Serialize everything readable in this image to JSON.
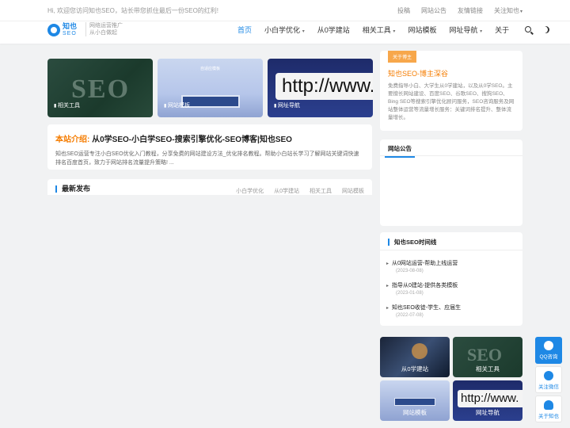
{
  "topbar": {
    "welcome": "Hi, 欢迎您访问知也SEO，站长带您抓住最后一份SEO的红利!",
    "links": [
      "投稿",
      "网站公告",
      "友情链接",
      "关注知也"
    ]
  },
  "header": {
    "logo_cn": "知也",
    "logo_en": "SEO",
    "slogan_1": "网络运营推广",
    "slogan_2": "从小白做起",
    "nav": [
      {
        "label": "首页",
        "dropdown": false
      },
      {
        "label": "小白学优化",
        "dropdown": true
      },
      {
        "label": "从0学建站",
        "dropdown": false
      },
      {
        "label": "相关工具",
        "dropdown": true
      },
      {
        "label": "网站模板",
        "dropdown": false
      },
      {
        "label": "网址导航",
        "dropdown": true
      },
      {
        "label": "关于",
        "dropdown": false
      }
    ],
    "accent": "#1e88e5"
  },
  "banners": [
    {
      "label": "相关工具",
      "art": "SEO"
    },
    {
      "label": "网站模板",
      "art": "自适应模板"
    },
    {
      "label": "网址导航",
      "art": "http://www."
    }
  ],
  "intro": {
    "tag": "本站介绍:",
    "title": "从0学SEO-小白学SEO-搜索引擎优化-SEO博客|知也SEO",
    "desc": "知也SEO运营专注小白SEO优化入门教程，分享免费的网站建设方法_优化排名教程。帮助小白站长学习了解网站关键词快速排名百度首页，致力于网站排名流量提升策略! ..."
  },
  "latest": {
    "title": "最新发布",
    "tabs": [
      "小白学优化",
      "从0学建站",
      "相关工具",
      "网站模板"
    ]
  },
  "about": {
    "tag": "关于博主",
    "title": "知也SEO-博主深谷",
    "desc": "免费指导小白、大学生从0学建站，以及从0学SEO。主要擅长网站建设、百度SEO、谷歌SEO、搜狗SEO、Bing SEO等搜索引擎优化顾问服务，SEO咨询服务及网站整体运营等流量增长服务：关键词排名提升、整体流量增长。"
  },
  "notice": {
    "title": "网站公告"
  },
  "timeline": {
    "title": "知也SEO时间线",
    "items": [
      {
        "text": "从0网站运营-帮助上线运营",
        "date": "(2023-08-08)"
      },
      {
        "text": "指导从0建站-提供各类模板",
        "date": "(2023-01-08)"
      },
      {
        "text": "知也SEO收徒-学生、应届生",
        "date": "(2022-07-08)"
      }
    ]
  },
  "tiles": [
    "从0学建站",
    "相关工具",
    "网站模板",
    "网址导航"
  ],
  "float_buttons": [
    {
      "label": "QQ咨询",
      "icon": "qq-icon"
    },
    {
      "label": "关注微信",
      "icon": "wechat-icon"
    },
    {
      "label": "关于知也",
      "icon": "user-icon"
    }
  ]
}
